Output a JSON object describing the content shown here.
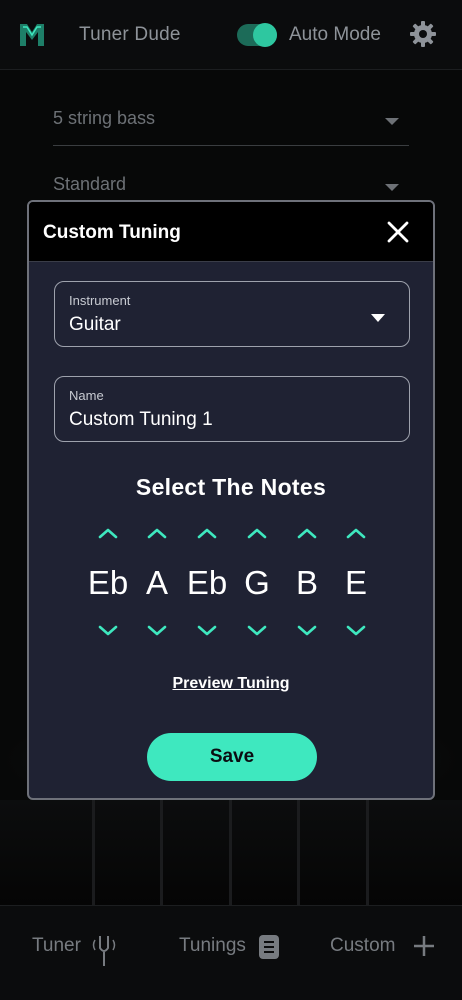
{
  "app": {
    "title": "Tuner Dude",
    "auto_mode_label": "Auto Mode",
    "auto_mode_on": true,
    "accent": "#3ee8bf"
  },
  "background": {
    "instrument_select": "5 string bass",
    "tuning_select": "Standard"
  },
  "tabs": [
    {
      "label": "Tuner",
      "icon": "tuning-fork-icon"
    },
    {
      "label": "Tunings",
      "icon": "document-icon"
    },
    {
      "label": "Custom",
      "icon": "plus-icon"
    }
  ],
  "modal": {
    "title": "Custom Tuning",
    "instrument": {
      "label": "Instrument",
      "value": "Guitar"
    },
    "name": {
      "label": "Name",
      "value": "Custom Tuning 1"
    },
    "notes_heading": "Select The Notes",
    "notes": [
      "Eb",
      "A",
      "Eb",
      "G",
      "B",
      "E"
    ],
    "preview_label": "Preview Tuning",
    "save_label": "Save"
  }
}
